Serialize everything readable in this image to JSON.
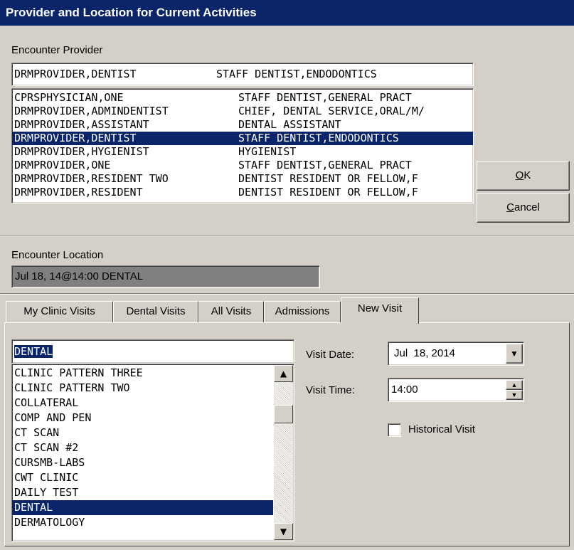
{
  "window": {
    "title": "Provider and Location for Current Activities"
  },
  "provider": {
    "label": "Encounter Provider",
    "selected_name": "DRMPROVIDER,DENTIST",
    "selected_title": "STAFF DENTIST,ENDODONTICS",
    "rows": [
      {
        "name": "CPRSPHYSICIAN,ONE",
        "title": "STAFF DENTIST,GENERAL PRACT",
        "selected": false
      },
      {
        "name": "DRMPROVIDER,ADMINDENTIST",
        "title": "CHIEF, DENTAL SERVICE,ORAL/M/",
        "selected": false
      },
      {
        "name": "DRMPROVIDER,ASSISTANT",
        "title": "DENTAL ASSISTANT",
        "selected": false
      },
      {
        "name": "DRMPROVIDER,DENTIST",
        "title": "STAFF DENTIST,ENDODONTICS",
        "selected": true
      },
      {
        "name": "DRMPROVIDER,HYGIENIST",
        "title": "HYGIENIST",
        "selected": false
      },
      {
        "name": "DRMPROVIDER,ONE",
        "title": "STAFF DENTIST,GENERAL PRACT",
        "selected": false
      },
      {
        "name": "DRMPROVIDER,RESIDENT TWO",
        "title": "DENTIST RESIDENT OR FELLOW,F",
        "selected": false
      },
      {
        "name": "DRMPROVIDER,RESIDENT",
        "title": "DENTIST RESIDENT OR FELLOW,F",
        "selected": false
      }
    ]
  },
  "buttons": {
    "ok": "OK",
    "cancel": "Cancel"
  },
  "location": {
    "label": "Encounter Location",
    "value": "Jul 18, 14@14:00 DENTAL"
  },
  "tabs": [
    {
      "label": "My Clinic Visits",
      "active": false
    },
    {
      "label": "Dental Visits",
      "active": false
    },
    {
      "label": "All Visits",
      "active": false
    },
    {
      "label": "Admissions",
      "active": false
    },
    {
      "label": "New Visit",
      "active": true
    }
  ],
  "new_visit": {
    "clinic_search_value": "DENTAL",
    "clinics": [
      {
        "label": "CLINIC PATTERN THREE",
        "selected": false
      },
      {
        "label": "CLINIC PATTERN TWO",
        "selected": false
      },
      {
        "label": "COLLATERAL",
        "selected": false
      },
      {
        "label": "COMP AND PEN",
        "selected": false
      },
      {
        "label": "CT SCAN",
        "selected": false
      },
      {
        "label": "CT SCAN #2",
        "selected": false
      },
      {
        "label": "CURSMB-LABS",
        "selected": false
      },
      {
        "label": "CWT CLINIC",
        "selected": false
      },
      {
        "label": "DAILY TEST",
        "selected": false
      },
      {
        "label": "DENTAL",
        "selected": true
      },
      {
        "label": "DERMATOLOGY",
        "selected": false
      }
    ],
    "visit_date_label": "Visit Date:",
    "visit_date_value": "Jul  18, 2014",
    "visit_time_label": "Visit Time:",
    "visit_time_value": "14:00",
    "historical_label": "Historical Visit",
    "historical_checked": false
  }
}
